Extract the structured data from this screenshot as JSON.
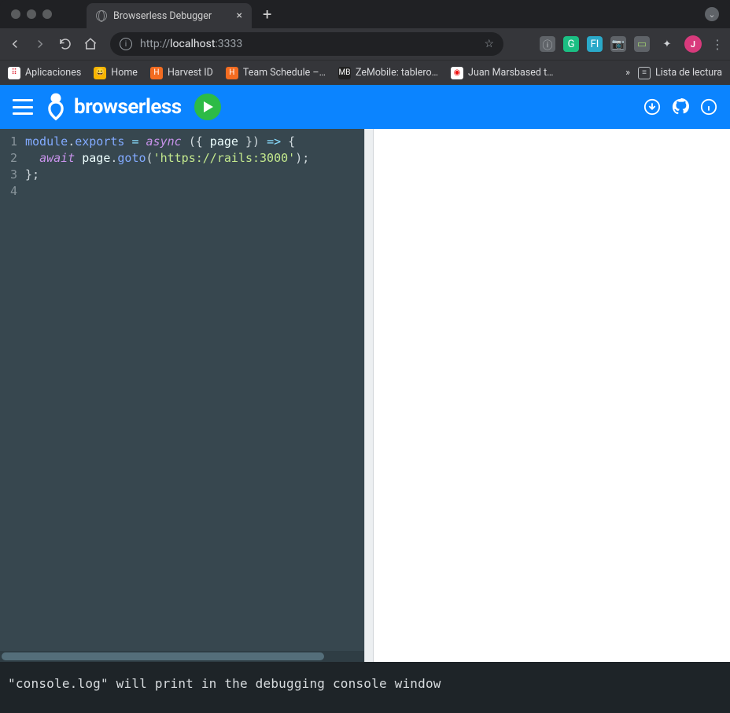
{
  "browser": {
    "tab_title": "Browserless Debugger",
    "new_tab_glyph": "+",
    "close_glyph": "×",
    "url_scheme": "http://",
    "url_host": "localhost",
    "url_port": ":3333",
    "star_glyph": "☆",
    "more_glyph": "»",
    "kebab_glyph": "⋮"
  },
  "bookmarks": [
    {
      "label": "Aplicaciones",
      "icon_bg": "#ffffff",
      "icon_text": "⠿",
      "icon_color": "#d23"
    },
    {
      "label": "Home",
      "icon_bg": "#f7b500",
      "icon_text": "😀",
      "icon_color": ""
    },
    {
      "label": "Harvest ID",
      "icon_bg": "#f36c21",
      "icon_text": "H",
      "icon_color": "#fff"
    },
    {
      "label": "Team Schedule –…",
      "icon_bg": "#f36c21",
      "icon_text": "H",
      "icon_color": "#fff"
    },
    {
      "label": "ZeMobile: tablero…",
      "icon_bg": "#222",
      "icon_text": "MB",
      "icon_color": "#fff"
    },
    {
      "label": "Juan Marsbased t…",
      "icon_bg": "#fff",
      "icon_text": "◉",
      "icon_color": "#e11"
    }
  ],
  "reading_list_label": "Lista de lectura",
  "avatar_initial": "J",
  "header": {
    "brand": "browserless"
  },
  "editor": {
    "line_numbers": [
      "1",
      "2",
      "3",
      "4"
    ],
    "code_tokens": [
      [
        {
          "t": "module",
          "c": "k-blue"
        },
        {
          "t": ".",
          "c": "k-punct"
        },
        {
          "t": "exports",
          "c": "k-blue"
        },
        {
          "t": " ",
          "c": ""
        },
        {
          "t": "=",
          "c": "k-cyan"
        },
        {
          "t": " ",
          "c": ""
        },
        {
          "t": "async",
          "c": "k-ital"
        },
        {
          "t": " ",
          "c": ""
        },
        {
          "t": "({",
          "c": "k-punct"
        },
        {
          "t": " page ",
          "c": "k-white"
        },
        {
          "t": "})",
          "c": "k-punct"
        },
        {
          "t": " ",
          "c": ""
        },
        {
          "t": "=>",
          "c": "k-cyan"
        },
        {
          "t": " ",
          "c": ""
        },
        {
          "t": "{",
          "c": "k-punct"
        }
      ],
      [
        {
          "t": "  ",
          "c": ""
        },
        {
          "t": "await",
          "c": "k-ital"
        },
        {
          "t": " ",
          "c": ""
        },
        {
          "t": "page",
          "c": "k-white"
        },
        {
          "t": ".",
          "c": "k-punct"
        },
        {
          "t": "goto",
          "c": "k-blue"
        },
        {
          "t": "(",
          "c": "k-punct"
        },
        {
          "t": "'https://rails:3000'",
          "c": "k-green"
        },
        {
          "t": ")",
          "c": "k-punct"
        },
        {
          "t": ";",
          "c": "k-punct"
        }
      ],
      [
        {
          "t": "};",
          "c": "k-punct"
        }
      ],
      [
        {
          "t": "",
          "c": ""
        }
      ]
    ]
  },
  "console_text": "\"console.log\" will print in the debugging console window",
  "ext_icons": [
    {
      "bg": "#5f6368",
      "fg": "#bcc0c4",
      "text": "ⓘ"
    },
    {
      "bg": "#1bbf83",
      "fg": "#fff",
      "text": "G"
    },
    {
      "bg": "#2aa9c9",
      "fg": "#fff",
      "text": "FI"
    },
    {
      "bg": "#5f6368",
      "fg": "#d0d3d6",
      "text": "📷"
    },
    {
      "bg": "#5f6368",
      "fg": "#9fcf6f",
      "text": "▭"
    }
  ],
  "puzzle_glyph": "✦"
}
